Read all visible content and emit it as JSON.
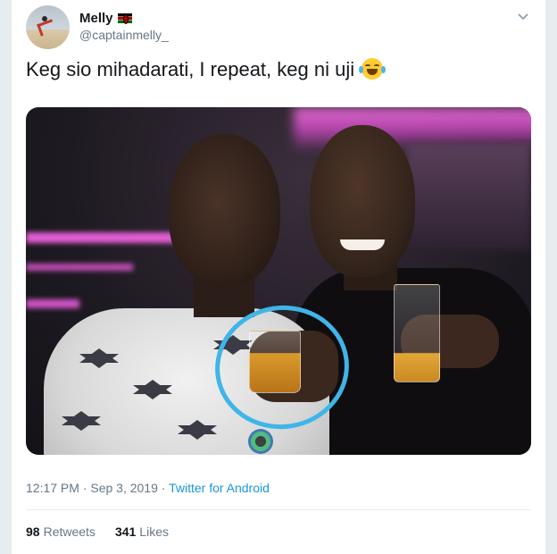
{
  "tweet": {
    "author": {
      "display_name": "Melly",
      "handle": "@captainmelly_",
      "flag_icon": "kenya-flag-icon",
      "avatar_icon": "avatar"
    },
    "menu_icon": "chevron-down-icon",
    "text": "Keg sio mihadarati, I repeat, keg ni uji",
    "emoji": "face-with-tears-of-joy-icon",
    "timestamp": "12:17 PM · Sep 3, 2019 · ",
    "source": "Twitter for Android",
    "stats": {
      "retweets_count": "98",
      "retweets_label": "Retweets",
      "likes_count": "341",
      "likes_label": "Likes"
    },
    "colors": {
      "link": "#1b95e0",
      "secondary_text": "#657786",
      "annotation_circle": "#3fb5e8"
    }
  }
}
